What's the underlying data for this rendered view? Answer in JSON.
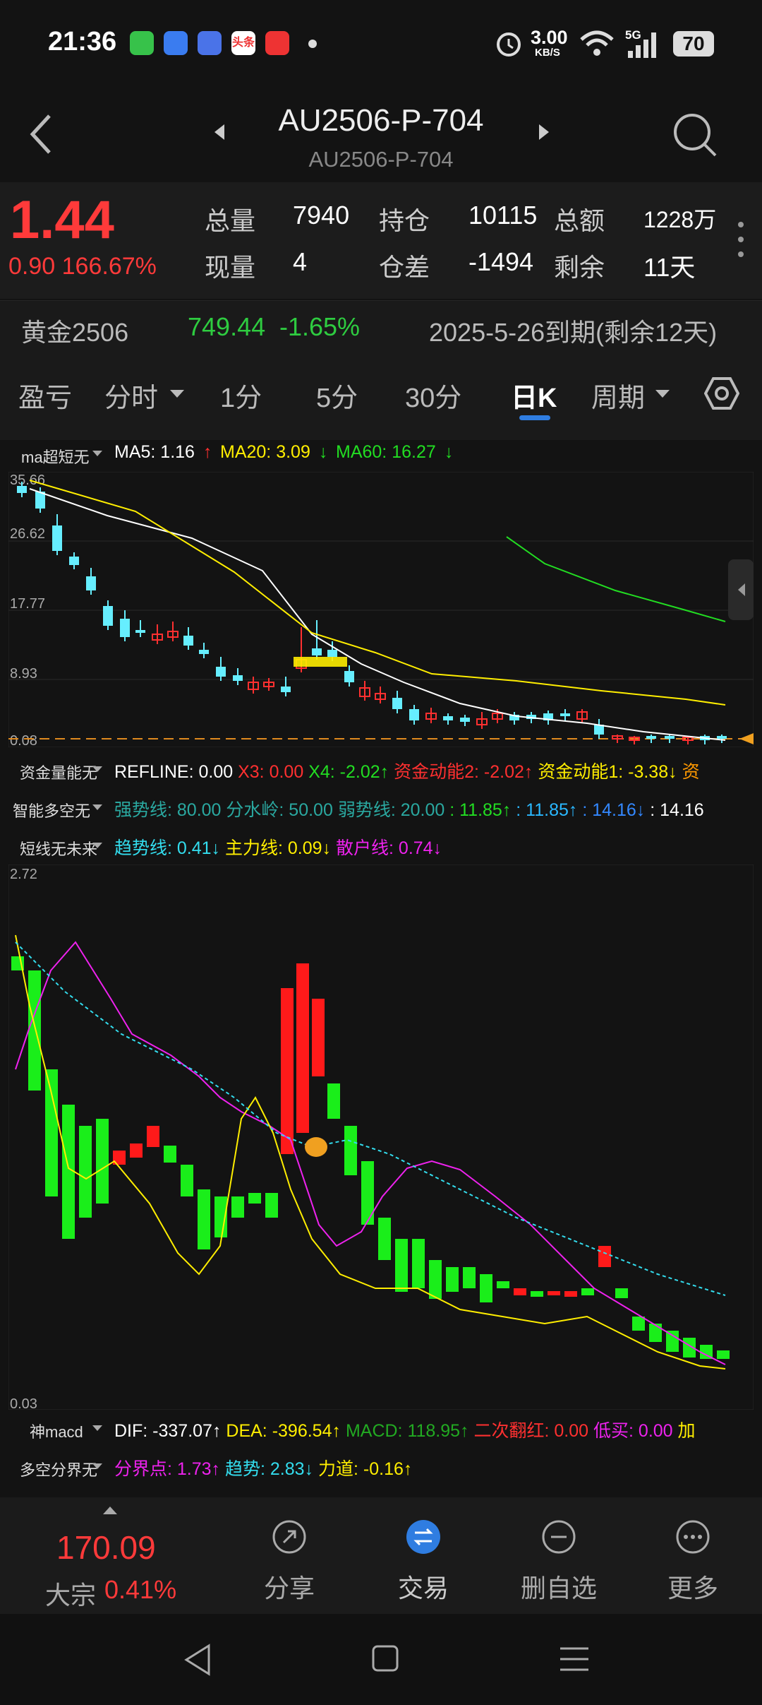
{
  "status": {
    "time": "21:36",
    "net_speed": "3.00",
    "net_unit": "KB/S",
    "network": "5G",
    "battery": "70"
  },
  "header": {
    "title": "AU2506-P-704",
    "subtitle": "AU2506-P-704"
  },
  "quote": {
    "price": "1.44",
    "change": "0.90",
    "change_pct": "166.67%",
    "stats": [
      {
        "label": "总量",
        "value": "7940"
      },
      {
        "label": "持仓",
        "value": "10115"
      },
      {
        "label": "总额",
        "value": "1228万"
      },
      {
        "label": "现量",
        "value": "4"
      },
      {
        "label": "仓差",
        "value": "-1494"
      },
      {
        "label": "剩余",
        "value": "11天"
      }
    ]
  },
  "underlying": {
    "name": "黄金2506",
    "price": "749.44",
    "change_pct": "-1.65%",
    "expiry": "2025-5-26到期(剩余12天)"
  },
  "tabs": [
    "盈亏",
    "分时",
    "1分",
    "5分",
    "30分",
    "日K",
    "周期"
  ],
  "active_tab": "日K",
  "ma_bar": {
    "selector": "ma超短无",
    "ma5": "MA5: 1.16",
    "ma20": "MA20: 3.09",
    "ma60": "MA60: 16.27"
  },
  "kline_axis": [
    "35.66",
    "26.62",
    "17.77",
    "8.93",
    "0.08"
  ],
  "indicator_rows": [
    {
      "selector": "资金量能无",
      "items": [
        {
          "text": "REFLINE: 0.00",
          "color": "#ffffff"
        },
        {
          "text": "X3: 0.00",
          "color": "#ff3030"
        },
        {
          "text": "X4: -2.02↑",
          "color": "#22dd22"
        },
        {
          "text": "资金动能2: -2.02↑",
          "color": "#ff3030"
        },
        {
          "text": "资金动能1: -3.38↓",
          "color": "#ffee00"
        },
        {
          "text": "资",
          "color": "#ff9900"
        }
      ]
    },
    {
      "selector": "智能多空无",
      "items": [
        {
          "text": "强势线: 80.00",
          "color": "#2aa8a0"
        },
        {
          "text": "分水岭: 50.00",
          "color": "#2aa8a0"
        },
        {
          "text": "弱势线: 20.00",
          "color": "#2aa8a0"
        },
        {
          "text": ": 11.85↑",
          "color": "#22dd22"
        },
        {
          "text": ": 11.85↑",
          "color": "#2ab8ff"
        },
        {
          "text": ": 14.16↓",
          "color": "#3388ff"
        },
        {
          "text": ": 14.16",
          "color": "#ffffff"
        }
      ]
    },
    {
      "selector": "短线无未来",
      "items": [
        {
          "text": "趋势线: 0.41↓",
          "color": "#33ddee"
        },
        {
          "text": "主力线: 0.09↓",
          "color": "#ffee00"
        },
        {
          "text": "散户线: 0.74↓",
          "color": "#ee22ee"
        }
      ]
    }
  ],
  "lower_axis": [
    "2.72",
    "0.03"
  ],
  "macd_row": {
    "selector": "神macd",
    "items": [
      {
        "text": "DIF: -337.07↑",
        "color": "#ffffff"
      },
      {
        "text": "DEA: -396.54↑",
        "color": "#ffee00"
      },
      {
        "text": "MACD: 118.95↑",
        "color": "#22aa22"
      },
      {
        "text": "二次翻红: 0.00",
        "color": "#ff3030"
      },
      {
        "text": "低买: 0.00",
        "color": "#ee22ee"
      },
      {
        "text": "加",
        "color": "#ffee00"
      }
    ]
  },
  "dk_row": {
    "selector": "多空分界无",
    "items": [
      {
        "text": "分界点: 1.73↑",
        "color": "#ee22ee"
      },
      {
        "text": "趋势: 2.83↓",
        "color": "#33ddee"
      },
      {
        "text": "力道: -0.16↑",
        "color": "#ffee00"
      }
    ]
  },
  "bottom_bar": {
    "index_value": "170.09",
    "index_name": "大宗",
    "index_pct": "0.41%",
    "buttons": [
      {
        "label": "分享",
        "icon": "share-icon"
      },
      {
        "label": "交易",
        "icon": "trade-icon"
      },
      {
        "label": "删自选",
        "icon": "remove-favorite-icon"
      },
      {
        "label": "更多",
        "icon": "more-icon"
      }
    ]
  },
  "colors": {
    "up": "#ff3030",
    "down": "#22dd22",
    "candle_down": "#66eeff",
    "accent": "#2f7de1"
  }
}
